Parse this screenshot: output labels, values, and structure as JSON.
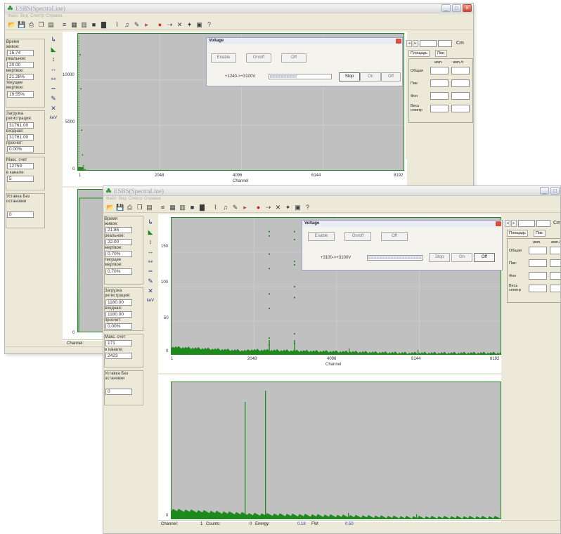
{
  "app": {
    "title": "ESBS(SpectraLine)"
  },
  "menu": [
    "Файл",
    "Вид",
    "Спектр",
    "Справка"
  ],
  "colors": {
    "plot_bg": "#c0c0c0",
    "trace": "#1e8a1e",
    "grid": "#d8d8d8",
    "close_btn": "#d0412c"
  },
  "toolbar_icons": [
    "open-icon",
    "save-icon",
    "print-icon",
    "copy-icon",
    "paste-icon",
    "bars-icon",
    "grid-icon",
    "table-icon",
    "stop-square-icon",
    "spectrum-icon",
    "chart-icon",
    "bell-icon",
    "pencil-icon",
    "play-icon",
    "record-icon",
    "step-icon",
    "cross-icon",
    "move-icon",
    "calculator-icon",
    "help-icon"
  ],
  "vtools": [
    {
      "icon": "cursor-icon",
      "glyph": "↳"
    },
    {
      "icon": "peak-icon",
      "glyph": "◣"
    },
    {
      "icon": "vertical-zoom-icon",
      "glyph": "↕"
    },
    {
      "icon": "horizontal-expand-icon",
      "glyph": "↔"
    },
    {
      "icon": "horizontal-shrink-icon",
      "glyph": "⇿"
    },
    {
      "icon": "range-icon",
      "glyph": "┅"
    },
    {
      "icon": "marker-icon",
      "glyph": "✎"
    },
    {
      "icon": "clear-icon",
      "glyph": "✕"
    },
    {
      "icon": "kev-icon",
      "glyph": "keV"
    }
  ],
  "back": {
    "left_panel": {
      "time_label": "Время",
      "live_label": "живое:",
      "live": "15.74",
      "real_label": "реальное:",
      "real": "20.00",
      "dead_label": "мертвое:",
      "dead": "21.28%",
      "cur_dead_label": "текущее мертвое:",
      "cur_dead": "19.55%",
      "load_label": "Загрузка регистрация:",
      "load": "31761.00",
      "input_label": "входная:",
      "input": "31761.00",
      "miss_label": "просчет:",
      "miss": "0.00%",
      "max_label": "Макс. счет",
      "max": "12759",
      "channel_label": "в канале:",
      "channel": "5",
      "setting_label": "Уставка Без остановки",
      "setting": "0"
    },
    "voltage": {
      "title": "Voltage",
      "btn_enable": "Enable",
      "btn_on": "On/off",
      "btn_off": "Off",
      "ramp": "+1240->+3100V",
      "progress": 0.45,
      "stop": "Stop",
      "on": "On",
      "off": "Off"
    },
    "right": {
      "units": "Cm",
      "tab1": "Площадь",
      "tab2": "Пик:"
    },
    "axis": {
      "y_ticks": [
        "10000",
        "5000",
        "0"
      ],
      "x_ticks": [
        "1",
        "2048",
        "4096",
        "6144",
        "8192"
      ],
      "xlabel": "Channel"
    },
    "status": {
      "channel_label": "Channel:"
    }
  },
  "front": {
    "left_panel": {
      "time_label": "Время",
      "live_label": "живое:",
      "live": "21.85",
      "real_label": "реальное:",
      "real": "22.00",
      "dead_label": "мертвое:",
      "dead": "0.70%",
      "cur_dead_label": "текущее мертвое:",
      "cur_dead": "0.70%",
      "load_label": "Загрузка регистрация:",
      "load": "1180.00",
      "input_label": "входная:",
      "input": "1180.00",
      "miss_label": "просчет:",
      "miss": "0.00%",
      "max_label": "Макс. счет",
      "max": "171",
      "channel_label": "в канале:",
      "channel": "2423",
      "setting_label": "Уставка Без остановки",
      "setting": "0"
    },
    "voltage": {
      "title": "Voltage",
      "btn_enable": "Enable",
      "btn_on": "On/off",
      "btn_off": "Off",
      "ramp": "+3100->+3100V",
      "progress": 1.0,
      "stop": "Stop",
      "on": "On",
      "off": "Off"
    },
    "right": {
      "units": "Cm",
      "tab1": "Площадь",
      "tab2": "Пик:",
      "col1": "имп.",
      "col2": "имп./с",
      "rows": [
        "Общая",
        "Пик:",
        "Фон",
        "Весь спектр"
      ]
    },
    "axis": {
      "y_ticks": [
        "150",
        "100",
        "50",
        "0"
      ],
      "x_ticks": [
        "1",
        "2048",
        "4096",
        "6144",
        "8192"
      ],
      "xlabel": "Channel"
    },
    "status": {
      "channel_label": "Channel:",
      "channel": "1",
      "counts_label": "Counts:",
      "counts": "0",
      "energy_label": "Energy:",
      "energy": "0.18",
      "fw_label": "FW:",
      "fw": "0.50"
    }
  },
  "chart_data": [
    {
      "type": "scatter",
      "title": "",
      "xlabel": "Channel",
      "ylabel": "",
      "xlim": [
        1,
        8192
      ],
      "ylim": [
        0,
        12759
      ],
      "grid": true,
      "series": [
        {
          "x": [
            20,
            40,
            60,
            80,
            100,
            140,
            200,
            400
          ],
          "y": [
            12700,
            9000,
            4500,
            1800,
            600,
            200,
            60,
            10
          ]
        }
      ]
    },
    {
      "type": "scatter",
      "title": "",
      "xlabel": "Channel",
      "ylabel": "",
      "xlim": [
        1,
        8192
      ],
      "ylim": [
        0,
        171
      ],
      "grid": true,
      "series": [
        {
          "x": [
            2423,
            2423,
            2423,
            2423,
            2423,
            2423,
            2423,
            2423,
            3050,
            3050,
            3050,
            3050,
            3050,
            3050,
            3050,
            3050
          ],
          "y": [
            171,
            165,
            140,
            120,
            85,
            65,
            24,
            15,
            171,
            160,
            130,
            125,
            95,
            80,
            30,
            17
          ]
        }
      ]
    }
  ]
}
